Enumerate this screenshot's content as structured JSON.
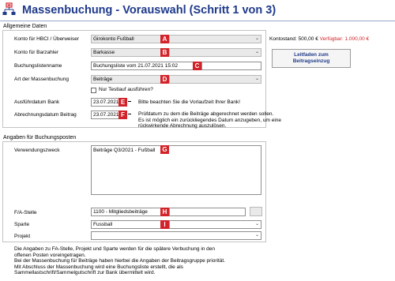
{
  "window": {
    "title": "Massenbuchung - Vorauswahl (Schritt 1 von 3)"
  },
  "sections": {
    "general": "Allgemeine Daten",
    "posting": "Angaben für Buchungsposten"
  },
  "fields": {
    "konto_hbci": {
      "label": "Konto für HBCI / Überweiser",
      "value": "Girokonto Fußball",
      "badge": "A"
    },
    "konto_barzahler": {
      "label": "Konto für Barzahler",
      "value": "Barkasse",
      "badge": "B"
    },
    "buchungslistenname": {
      "label": "Buchungslistenname",
      "value": "Buchungsliste vom 21.07.2021 15:02",
      "badge": "C"
    },
    "art": {
      "label": "Art der Massenbuchung",
      "value": "Beiträge",
      "badge": "D"
    },
    "testlauf": {
      "label": "Nur Testlauf ausführen?"
    },
    "ausfuehrdatum": {
      "label": "Ausführdatum Bank",
      "value": "23.07.2021",
      "badge": "E",
      "hint": "Bitte beachten Sie die Vorlaufzeit Ihrer Bank!"
    },
    "abrechnungsdatum": {
      "label": "Abrechnungsdatum Beitrag",
      "value": "23.07.2021",
      "badge": "F",
      "hint1": "Prüfdatum zu dem die Beiträge abgerechnet werden sollen.",
      "hint2": "Es ist möglich ein zurückliegendes Datum anzugeben, um eine",
      "hint3": "rückwirkende Abrechnung auszulösen."
    },
    "verwendungszweck": {
      "label": "Verwendungszweck",
      "value": "Beiträge Q3/2021 - Fußball",
      "badge": "G"
    },
    "fa_stelle": {
      "label": "F/A-Stelle",
      "value": "1100 - Mitgliedsbeiträge",
      "badge": "H"
    },
    "sparte": {
      "label": "Sparte",
      "value": "Fussball",
      "badge": "I"
    },
    "projekt": {
      "label": "Projekt",
      "value": ""
    }
  },
  "balance": {
    "label": "Kontostand:",
    "kontostand": "500,00 €",
    "verfuegbar_label": "Verfügbar:",
    "verfuegbar": "1.000,00 €"
  },
  "buttons": {
    "leitfaden_line1": "Leitfaden zum",
    "leitfaden_line2": "Beitragseinzug"
  },
  "footer": {
    "line1": "Die Angaben zu FA-Stelle, Projekt und Sparte werden für die spätere Verbuchung in den",
    "line2": "offenen Posten voreingetragen.",
    "line3": "Bei der Massenbuchung für Beiträge haben hierbei die Angaben der Beitragsgruppe priorität.",
    "line4": "Mit Abschluss der Massenbuchung wird eine Buchungsliste erstellt, die als",
    "line5": "Sammellastschrift/Sammelgutschrift zur Bank übermittelt wird."
  },
  "colors": {
    "badge": "#d3232a",
    "title": "#1f3a8a",
    "negative": "#d3232a"
  },
  "icons": {
    "app": "network-hierarchy-icon",
    "dropdown": "chevron-down-icon",
    "calendar": "date-picker-dash"
  }
}
